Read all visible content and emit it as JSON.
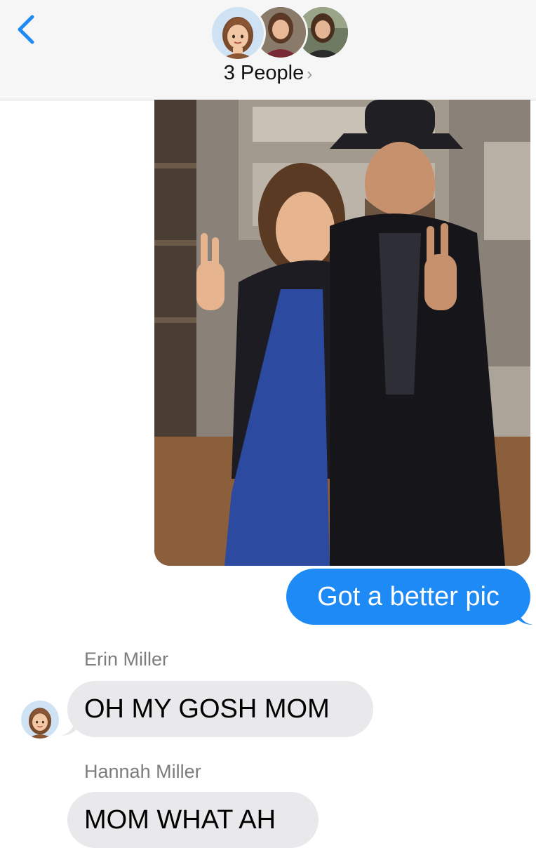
{
  "header": {
    "title": "3 People",
    "chevron": "›",
    "back_icon": "chevron-left-icon",
    "accent": "#1d8af5"
  },
  "messages": [
    {
      "type": "image",
      "direction": "outgoing"
    },
    {
      "type": "text",
      "direction": "outgoing",
      "text": "Got a better pic"
    },
    {
      "type": "text",
      "direction": "incoming",
      "sender": "Erin Miller",
      "text": "OH MY GOSH MOM"
    },
    {
      "type": "text",
      "direction": "incoming",
      "sender": "Hannah  Miller",
      "text": "MOM WHAT AH"
    }
  ],
  "colors": {
    "outgoing_bubble": "#1d8af5",
    "incoming_bubble": "#e9e9eb",
    "sender_name": "#7d7d7d"
  }
}
